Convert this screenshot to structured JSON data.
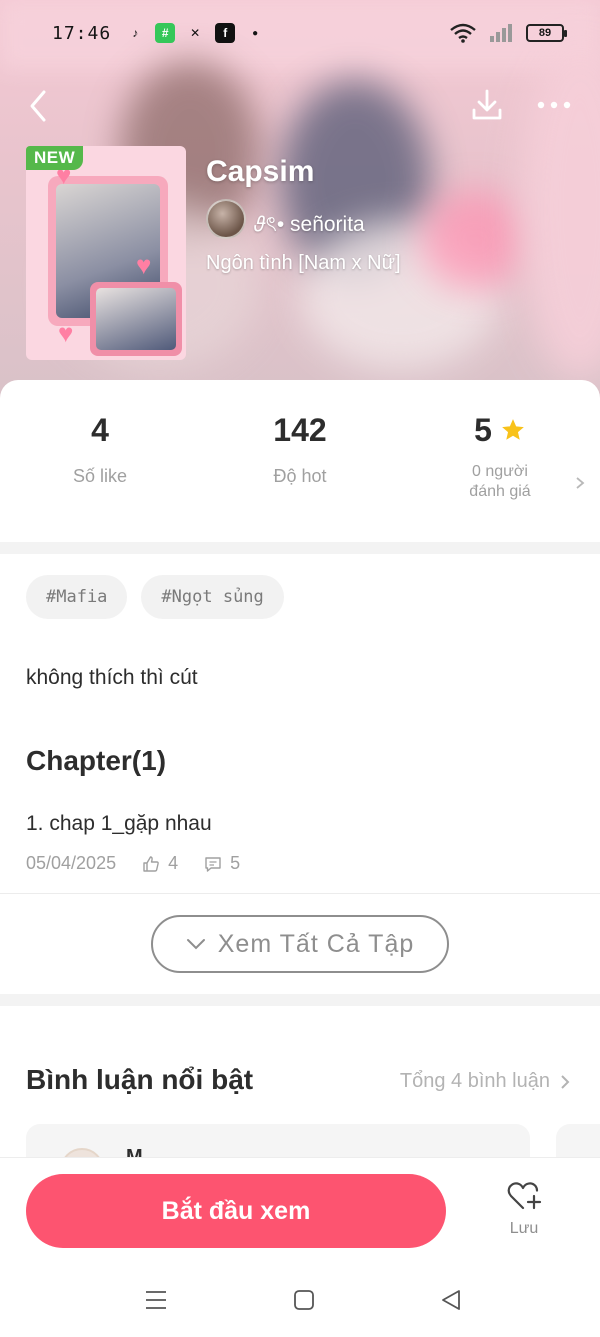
{
  "status_bar": {
    "time": "17:46",
    "battery": "89"
  },
  "header": {
    "badge": "NEW",
    "title": "Capsim",
    "author": "𝜗ৎ• señorita",
    "genre": "Ngôn tình [Nam x Nữ]"
  },
  "stats": {
    "likes_value": "4",
    "likes_label": "Số like",
    "hot_value": "142",
    "hot_label": "Độ hot",
    "rating_value": "5",
    "rating_label_line1": "0 người",
    "rating_label_line2": "đánh giá"
  },
  "tags": [
    "#Mafia",
    "#Ngọt sủng"
  ],
  "description": "không thích thì cút",
  "chapters": {
    "heading": "Chapter(1)",
    "items": [
      {
        "title": "1. chap 1_gặp nhau",
        "date": "05/04/2025",
        "likes": "4",
        "comments": "5"
      }
    ],
    "view_all_label": "Xem Tất Cả Tập"
  },
  "comments": {
    "heading": "Bình luận nổi bật",
    "total": "Tổng 4 bình luận",
    "first_name": "M"
  },
  "bottom": {
    "start_label": "Bắt đầu xem",
    "save_label": "Lưu"
  },
  "colors": {
    "accent": "#fd5470",
    "star": "#f8c21a",
    "badge_new": "#55b84a"
  },
  "icons": {
    "back": "chevron-left-icon",
    "download": "download-icon",
    "more": "more-dots-icon",
    "star": "star-icon",
    "like": "thumb-up-icon",
    "comment": "comment-icon",
    "chevron_down": "chevron-down-icon",
    "chevron_right": "chevron-right-icon",
    "heart_plus": "heart-plus-icon"
  }
}
